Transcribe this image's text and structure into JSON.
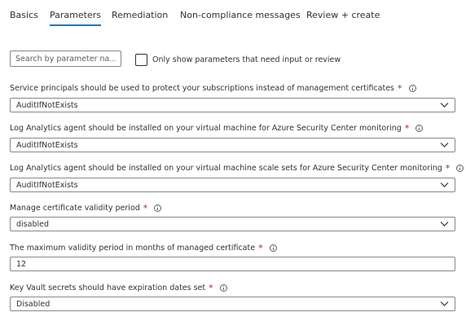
{
  "tabs": [
    {
      "label": "Basics"
    },
    {
      "label": "Parameters"
    },
    {
      "label": "Remediation"
    },
    {
      "label": "Non-compliance messages"
    },
    {
      "label": "Review + create"
    }
  ],
  "search": {
    "placeholder": "Search by parameter na..."
  },
  "filter": {
    "label": "Only show parameters that need input or review"
  },
  "params": [
    {
      "label": "Service principals should be used to protect your subscriptions instead of management certificates",
      "value": "AuditIfNotExists"
    },
    {
      "label": "Log Analytics agent should be installed on your virtual machine for Azure Security Center monitoring",
      "value": "AuditIfNotExists"
    },
    {
      "label": "Log Analytics agent should be installed on your virtual machine scale sets for Azure Security Center monitoring",
      "value": "AuditIfNotExists"
    },
    {
      "label": "Manage certificate validity period",
      "value": "disabled"
    },
    {
      "label": "The maximum validity period in months of managed certificate",
      "value": "12"
    },
    {
      "label": "Key Vault secrets should have expiration dates set",
      "value": "Disabled"
    }
  ],
  "required_marker": "*",
  "colors": {
    "accent": "#0078d4",
    "required": "#a4262c",
    "border": "#8a8886"
  },
  "icons": {
    "info": "info-icon",
    "dropdown": "chevron-down-icon",
    "checkbox": "checkbox"
  }
}
